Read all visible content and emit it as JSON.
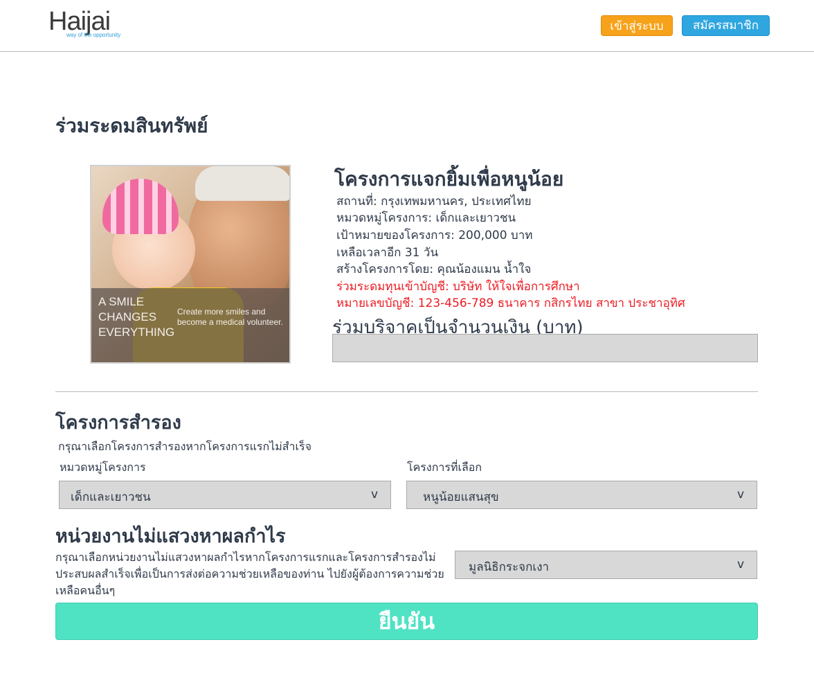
{
  "header": {
    "logo_text": "Haijai",
    "logo_tagline": "way of the opportunity",
    "login_label": "เข้าสู่ระบบ",
    "register_label": "สมัครสมาชิก"
  },
  "page": {
    "title": "ร่วมระดมสินทรัพย์"
  },
  "project": {
    "image_headline": "A SMILE CHANGES EVERYTHING",
    "image_subtext": "Create more smiles and become a medical volunteer.",
    "name": "โครงการแจกยิ้มเพื่อหนูน้อย",
    "location": "สถานที่: กรุงเทพมหานคร, ประเทศไทย",
    "category": "หมวดหมู่โครงการ: เด็กและเยาวชน",
    "goal": "เป้าหมายของโครงการ: 200,000 บาท",
    "time_left": "เหลือเวลาอีก 31 วัน",
    "creator": "สร้างโครงการโดย: คุณน้องแมน น้ำใจ",
    "account_name": "ร่วมระดมทุนเข้าบัญชี: บริษัท ให้ใจเพื่อการศึกษา",
    "account_number": "หมายเลขบัญชี: 123-456-789 ธนาคาร กสิกรไทย สาขา ประชาอุทิศ",
    "donate_label": "ร่วมบริจาคเป็นจำนวนเงิน (บาท)",
    "donate_value": ""
  },
  "backup": {
    "title": "โครงการสำรอง",
    "description": "กรุณาเลือกโครงการสำรองหากโครงการแรกไม่สำเร็จ",
    "category_label": "หมวดหมู่โครงการ",
    "category_value": "เด็กและเยาวชน",
    "project_label": "โครงการที่เลือก",
    "project_value": "หนูน้อยแสนสุข",
    "caret": "v"
  },
  "nonprofit": {
    "title": "หน่วยงานไม่แสวงหาผลกำไร",
    "description": "กรุณาเลือกหน่วยงานไม่แสวงหาผลกำไรหากโครงการแรกและโครงการสำรองไม่ประสบผลสำเร็จเพื่อเป็นการส่งต่อความช่วยเหลือของท่าน ไปยังผู้ต้องการความช่วยเหลือคนอื่นๆ",
    "org_value": "มูลนิธิกระจกเงา"
  },
  "confirm_label": "ยืนยัน",
  "colors": {
    "login_button": "#f7a21b",
    "register_button": "#2fa6df",
    "confirm_button": "#4fe3c4",
    "account_text": "#ec1c24",
    "heading_text": "#2f3a4a"
  }
}
